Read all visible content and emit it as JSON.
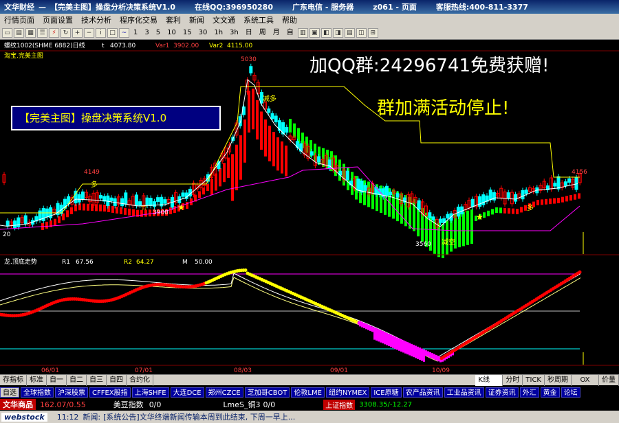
{
  "titlebar": {
    "app": "文华财经",
    "title": "【完美主图】操盘分析决策系统V1.0",
    "qq": "在线QQ:396950280",
    "telecom": "广东电信 - 服务器",
    "page": "z061 - 页面",
    "hotline": "客服热线:400-811-3377"
  },
  "menu": [
    "行情页面",
    "页面设置",
    "技术分析",
    "程序化交易",
    "套利",
    "新闻",
    "文文通",
    "系统工具",
    "帮助"
  ],
  "toolbar_periods": [
    "1",
    "3",
    "5",
    "10",
    "15",
    "30",
    "1h",
    "3h",
    "日",
    "周",
    "月",
    "自"
  ],
  "chart": {
    "contract": "螺纹1002(SHME 6882)日线",
    "t_label": "t",
    "t_value": "4073.80",
    "var1_label": "Var1",
    "var1_value": "3902.00",
    "var2_label": "Var2",
    "var2_value": "4115.00",
    "main_title": "淘宝.完美主图",
    "promo1": "加QQ群:24296741免费获赠!",
    "promo2": "群加满活动停止!",
    "system_box": "【完美主图】操盘决策系统V1.0",
    "high_price": "5030",
    "peak_label1": "4149",
    "peak_label2": "4156",
    "low_label1": "3900",
    "low_label2": "3560",
    "many1": "多",
    "many2": "多",
    "many3": "多",
    "reduce1": "减多",
    "reduce2": "减空",
    "left_price": "20",
    "indicator_title": "龙.顶底走势",
    "r1_label": "R1",
    "r1_value": "67.56",
    "r2_label": "R2",
    "r2_value": "64.27",
    "m_label": "M",
    "m_value": "50.00",
    "dates": [
      "06/01",
      "07/01",
      "08/03",
      "09/01",
      "10/09"
    ]
  },
  "bottom_tabs": [
    "存指标",
    "标准",
    "自一",
    "自二",
    "自三",
    "自四",
    "合约化"
  ],
  "bottom_right": [
    "K线",
    "分时",
    "TICK",
    "秒周期",
    "OX",
    "价量"
  ],
  "market_tabs": [
    "自选",
    "全球指数",
    "沪深股票",
    "CFFEX股指",
    "上海SHFE",
    "大连DCE",
    "郑州CZCE",
    "芝加哥CBOT",
    "伦敦LME",
    "纽约NYMEX",
    "ICE原糖",
    "农产品资讯",
    "工业品资讯",
    "证券资讯",
    "外汇",
    "黄金",
    "论坛"
  ],
  "ticker": {
    "brand": "文华商品",
    "brand_value": "162.07/0.55",
    "item1_label": "美豆指数",
    "item1_value": "0/0",
    "item2_label": "LmeS_铜3",
    "item2_value": "0/0",
    "item3_label": "上证指数",
    "item3_value": "3308.35/-12.27"
  },
  "news": {
    "logo": "webstock",
    "time": "11:12",
    "label": "新闻:",
    "text": "[系统公告]文华终端新闻传输本周到此结束, 下周一早上..."
  },
  "colors": {
    "up": "#ff0000",
    "down": "#00ffff",
    "green_band": "#00ff00",
    "red_band": "#ff0000",
    "line_yellow": "#ffff00",
    "line_magenta": "#ff00ff"
  }
}
